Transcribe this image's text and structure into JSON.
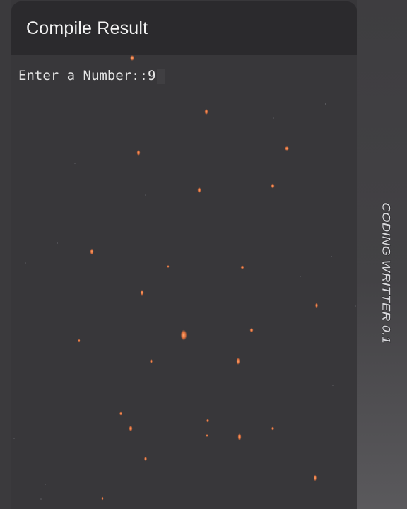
{
  "header": {
    "title": "Compile Result"
  },
  "console": {
    "output_line": "Enter a Number::9"
  },
  "watermark": {
    "text": "CODING WRITTER 0.1"
  },
  "colors": {
    "background": "#3a393c",
    "title_bar": "#2b2a2d",
    "text": "#e6e6e6",
    "spark": "#ff7a3c"
  }
}
